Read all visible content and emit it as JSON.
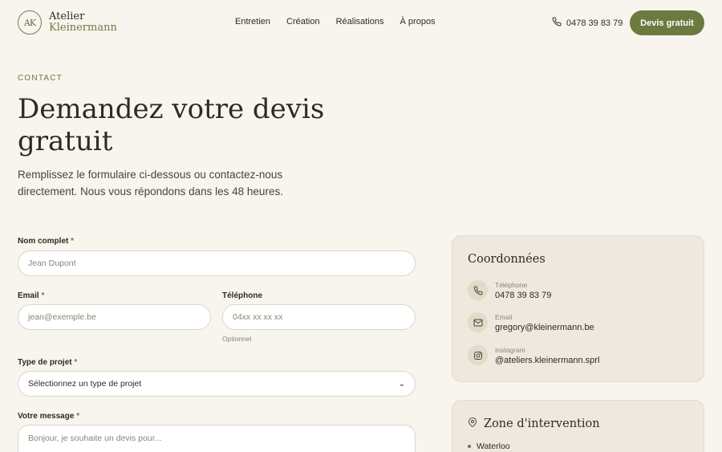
{
  "brand": {
    "monogram": "AK",
    "line1": "Atelier",
    "line2": "Kleinermann"
  },
  "nav": {
    "items": [
      "Entretien",
      "Création",
      "Réalisations",
      "À propos"
    ]
  },
  "header": {
    "phone": "0478 39 83 79",
    "cta": "Devis gratuit"
  },
  "hero": {
    "eyebrow": "CONTACT",
    "title": "Demandez votre devis gratuit",
    "lead": "Remplissez le formulaire ci-dessous ou contactez-nous directement. Nous vous répondons dans les 48 heures."
  },
  "form": {
    "name": {
      "label": "Nom complet",
      "required": "*",
      "placeholder": "Jean Dupont"
    },
    "email": {
      "label": "Email",
      "required": "*",
      "placeholder": "jean@exemple.be"
    },
    "phone": {
      "label": "Téléphone",
      "placeholder": "04xx xx xx xx",
      "hint": "Optionnel"
    },
    "project": {
      "label": "Type de projet",
      "required": "*",
      "selected": "Sélectionnez un type de projet"
    },
    "message": {
      "label": "Votre message",
      "required": "*",
      "placeholder": "Bonjour, je souhaite un devis pour..."
    }
  },
  "contact_card": {
    "title": "Coordonnées",
    "items": [
      {
        "label": "Téléphone",
        "value": "0478 39 83 79",
        "icon": "phone-icon"
      },
      {
        "label": "Email",
        "value": "gregory@kleinermann.be",
        "icon": "mail-icon"
      },
      {
        "label": "Instagram",
        "value": "@ateliers.kleinermann.sprl",
        "icon": "instagram-icon"
      }
    ]
  },
  "zone_card": {
    "title": "Zone d'intervention",
    "items": [
      "Waterloo"
    ]
  },
  "colors": {
    "accent": "#6b7a3e",
    "background": "#f8f5ef",
    "card": "#efe8de",
    "text": "#2f2a24"
  }
}
